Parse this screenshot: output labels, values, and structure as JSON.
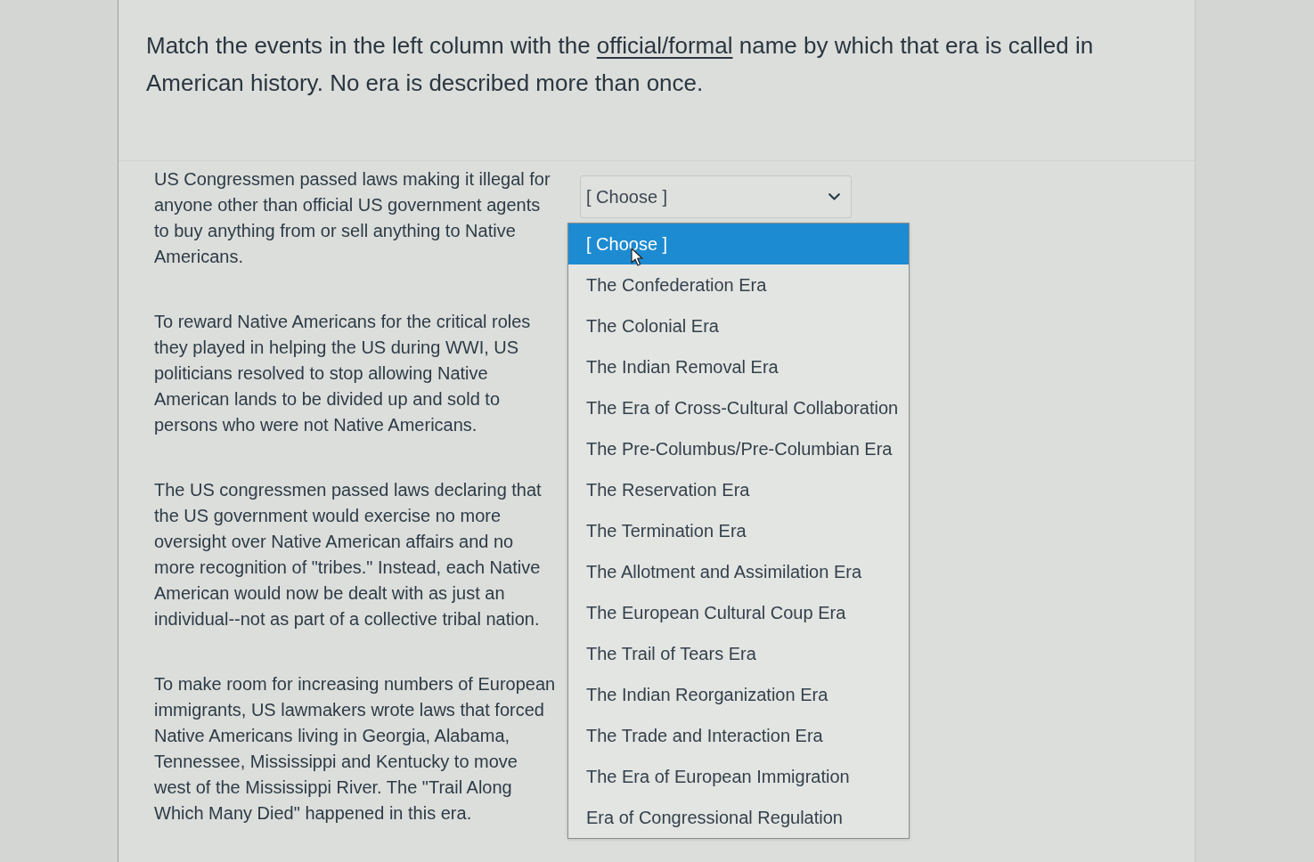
{
  "prompt": {
    "before": "Match the events in the left column with the ",
    "underlined": "official/formal",
    "after": " name by which that era is called in American history. No era is described more than once."
  },
  "matches": [
    {
      "event": "US Congressmen passed laws making it illegal for anyone other than official US government agents to buy anything from or sell anything to Native Americans.",
      "select": {
        "value": "[ Choose ]",
        "expanded": true,
        "options": [
          {
            "label": "[ Choose ]",
            "selected": true
          },
          {
            "label": "The Confederation Era",
            "selected": false
          },
          {
            "label": "The Colonial Era",
            "selected": false
          },
          {
            "label": "The Indian Removal Era",
            "selected": false
          },
          {
            "label": "The Era of Cross-Cultural Collaboration",
            "selected": false
          },
          {
            "label": "The Pre-Columbus/Pre-Columbian Era",
            "selected": false
          },
          {
            "label": "The Reservation Era",
            "selected": false
          },
          {
            "label": "The Termination Era",
            "selected": false
          },
          {
            "label": "The Allotment and Assimilation Era",
            "selected": false
          },
          {
            "label": "The European Cultural Coup Era",
            "selected": false
          },
          {
            "label": "The Trail of Tears Era",
            "selected": false
          },
          {
            "label": "The Indian Reorganization Era",
            "selected": false
          },
          {
            "label": "The Trade and Interaction Era",
            "selected": false
          },
          {
            "label": "The Era of European Immigration",
            "selected": false
          },
          {
            "label": "Era of Congressional Regulation",
            "selected": false
          }
        ]
      }
    },
    {
      "event": "To reward Native Americans for the critical roles they played in helping the US during WWI, US politicians resolved to stop allowing Native American lands to be divided up and sold to persons who were not Native Americans."
    },
    {
      "event": "The US congressmen passed laws declaring that the US government would exercise no more oversight over Native American affairs and no more recognition of \"tribes.\" Instead, each Native American would now be dealt with as just an individual--not as part of a collective tribal nation."
    },
    {
      "event": "To make room for increasing numbers of European immigrants, US lawmakers wrote laws that forced Native Americans living in Georgia, Alabama, Tennessee, Mississippi and Kentucky to move west of the Mississippi River. The \"Trail Along Which Many Died\" happened in this era."
    }
  ]
}
